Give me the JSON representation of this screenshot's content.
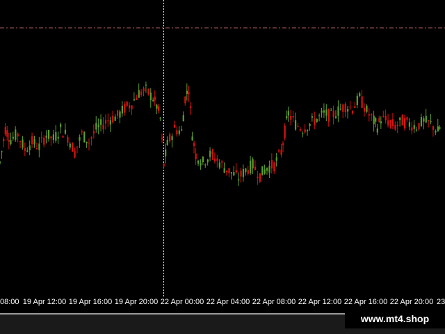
{
  "colors": {
    "background": "#000000",
    "bull": "#5aa02c",
    "bear": "#e01010",
    "level_line": "#b06060",
    "separator": "#ffffff",
    "axis_text": "#ffffff"
  },
  "chart_data": {
    "type": "candlestick",
    "x_tick_labels": [
      "08:00",
      "19 Apr 12:00",
      "19 Apr 16:00",
      "19 Apr 20:00",
      "22 Apr 00:00",
      "22 Apr 04:00",
      "22 Apr 08:00",
      "22 Apr 12:00",
      "22 Apr 16:00",
      "22 Apr 20:00",
      "23"
    ],
    "level": 100,
    "close_path": [
      [
        0,
        45
      ],
      [
        3,
        58
      ],
      [
        6,
        54
      ],
      [
        10,
        56
      ],
      [
        14,
        50
      ],
      [
        18,
        53
      ],
      [
        22,
        51
      ],
      [
        26,
        56
      ],
      [
        30,
        54
      ],
      [
        34,
        58
      ],
      [
        38,
        55
      ],
      [
        42,
        49
      ],
      [
        46,
        56
      ],
      [
        50,
        53
      ],
      [
        54,
        58
      ],
      [
        58,
        60
      ],
      [
        62,
        62
      ],
      [
        66,
        63
      ],
      [
        70,
        66
      ],
      [
        74,
        68
      ],
      [
        78,
        72
      ],
      [
        82,
        73
      ],
      [
        86,
        70
      ],
      [
        88,
        67
      ],
      [
        90,
        62
      ],
      [
        92,
        44
      ],
      [
        94,
        52
      ],
      [
        98,
        58
      ],
      [
        102,
        57
      ],
      [
        104,
        70
      ],
      [
        106,
        74
      ],
      [
        108,
        56
      ],
      [
        110,
        48
      ],
      [
        114,
        45
      ],
      [
        118,
        48
      ],
      [
        122,
        46
      ],
      [
        126,
        43
      ],
      [
        130,
        41
      ],
      [
        134,
        39
      ],
      [
        138,
        42
      ],
      [
        142,
        44
      ],
      [
        146,
        40
      ],
      [
        150,
        43
      ],
      [
        154,
        44
      ],
      [
        158,
        49
      ],
      [
        160,
        57
      ],
      [
        162,
        64
      ],
      [
        166,
        60
      ],
      [
        170,
        58
      ],
      [
        174,
        60
      ],
      [
        178,
        62
      ],
      [
        182,
        64
      ],
      [
        186,
        63
      ],
      [
        190,
        65
      ],
      [
        194,
        67
      ],
      [
        198,
        66
      ],
      [
        202,
        70
      ],
      [
        206,
        65
      ],
      [
        210,
        61
      ],
      [
        212,
        59
      ],
      [
        214,
        62
      ],
      [
        218,
        61
      ],
      [
        222,
        59
      ],
      [
        226,
        61
      ],
      [
        230,
        60
      ],
      [
        234,
        59
      ],
      [
        238,
        61
      ],
      [
        242,
        60
      ],
      [
        246,
        57
      ],
      [
        248,
        60
      ]
    ],
    "ylim": [
      0,
      100
    ],
    "session_break_x": 92
  }
}
